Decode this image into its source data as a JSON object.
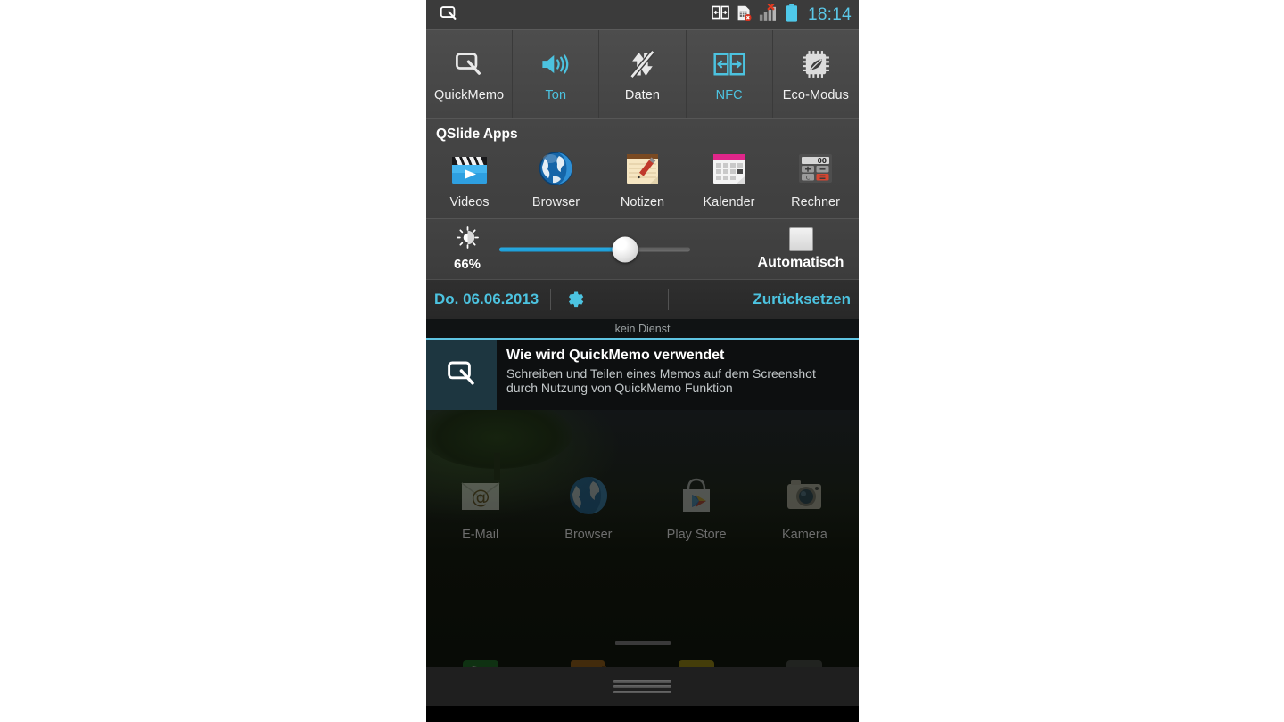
{
  "statusbar": {
    "quickmemo_icon": "quickmemo-icon",
    "nfc_icon": "nfc-icon",
    "sim_error_icon": "sim-card-error-icon",
    "signal_icon": "signal-bars-no-service-icon",
    "battery_icon": "battery-icon",
    "clock": "18:14",
    "clock_color": "#5bc8e8"
  },
  "toggles": [
    {
      "label": "QuickMemo",
      "icon": "quickmemo-icon",
      "state": "off"
    },
    {
      "label": "Ton",
      "icon": "sound-speaker-icon",
      "state": "on"
    },
    {
      "label": "Daten",
      "icon": "mobile-data-off-icon",
      "state": "off"
    },
    {
      "label": "NFC",
      "icon": "nfc-icon",
      "state": "on"
    },
    {
      "label": "Eco-Modus",
      "icon": "eco-mode-chip-leaf-icon",
      "state": "off"
    }
  ],
  "qslide": {
    "title": "QSlide Apps",
    "apps": [
      {
        "label": "Videos",
        "icon": "videos-clapperboard-icon"
      },
      {
        "label": "Browser",
        "icon": "browser-globe-icon"
      },
      {
        "label": "Notizen",
        "icon": "notes-notepad-pencil-icon"
      },
      {
        "label": "Kalender",
        "icon": "calendar-icon"
      },
      {
        "label": "Rechner",
        "icon": "calculator-icon"
      }
    ]
  },
  "brightness": {
    "icon": "brightness-sun-icon",
    "percent_label": "66%",
    "percent_value": 66,
    "auto_label": "Automatisch",
    "auto_checked": false,
    "fill_color": "#1b9ed8"
  },
  "daterow": {
    "date": "Do. 06.06.2013",
    "settings_icon": "gear-icon",
    "reset_label": "Zurücksetzen",
    "accent_color": "#4cc3e0"
  },
  "service_status": "kein Dienst",
  "notification": {
    "icon": "quickmemo-icon",
    "title": "Wie wird QuickMemo verwendet",
    "text": "Schreiben und Teilen eines Memos auf dem Screenshot durch Nutzung von QuickMemo Funktion"
  },
  "homescreen": {
    "apps": [
      {
        "label": "E-Mail",
        "icon": "email-envelope-icon"
      },
      {
        "label": "Browser",
        "icon": "browser-globe-icon"
      },
      {
        "label": "Play Store",
        "icon": "play-store-icon"
      },
      {
        "label": "Kamera",
        "icon": "camera-icon"
      }
    ],
    "dock": [
      {
        "icon": "phone-icon"
      },
      {
        "icon": "contacts-icon"
      },
      {
        "icon": "messaging-icon"
      },
      {
        "icon": "app-drawer-icon"
      }
    ]
  },
  "navbar": {
    "handle": "pull-handle"
  }
}
